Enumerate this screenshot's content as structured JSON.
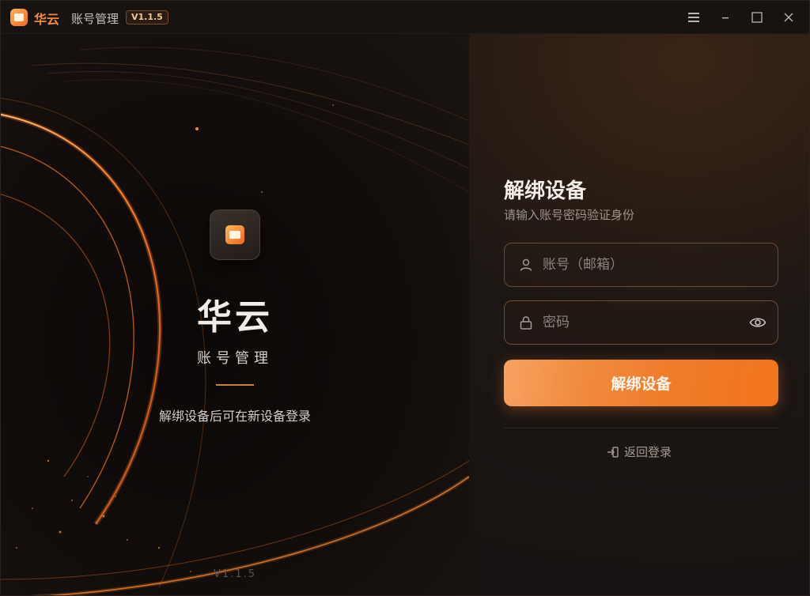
{
  "titlebar": {
    "brand": "华云",
    "title": "账号管理",
    "version": "V1.1.5",
    "icons": [
      "menu-icon",
      "minimize-icon",
      "maximize-icon",
      "close-icon"
    ]
  },
  "hero": {
    "name": "华云",
    "subtitle": "账号管理",
    "description": "解绑设备后可在新设备登录",
    "version": "V1.1.5"
  },
  "form": {
    "title": "解绑设备",
    "subtitle": "请输入账号密码验证身份",
    "account_placeholder": "账号（邮箱）",
    "password_placeholder": "密码",
    "submit_label": "解绑设备",
    "back_label": "返回登录"
  },
  "colors": {
    "accent": "#f07c2a",
    "brand": "#f58a38",
    "background": "#161312"
  }
}
